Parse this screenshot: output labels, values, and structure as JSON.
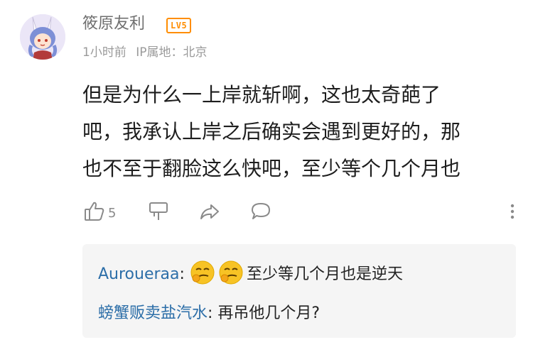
{
  "comment": {
    "username": "筱原友利",
    "level": "LV5",
    "time": "1小时前",
    "ip_location": "IP属地：北京",
    "lines": [
      "但是为什么一上岸就斩啊，这也太奇葩了",
      "吧，我承认上岸之后确实会遇到更好的，那",
      "也不至于翻脸这么快吧，至少等个几个月也"
    ],
    "like_count": "5"
  },
  "icons": {
    "like": "thumb-up-icon",
    "dislike": "thumb-down-icon",
    "share": "share-arrow-icon",
    "comment": "comment-bubble-icon",
    "more": "more-vertical-icon",
    "emoji": "smirk-face-emoji"
  },
  "replies": [
    {
      "author": "Auroueraa",
      "separator": ":",
      "text": "至少等几个月也是逆天"
    },
    {
      "author": "螃蟹贩卖盐汽水",
      "separator": ":",
      "text": " 再吊他几个月?"
    }
  ],
  "colors": {
    "reply_author": "#2c6ea8",
    "level_badge": "#ff8d00",
    "reply_bg": "#f5f5f5"
  }
}
